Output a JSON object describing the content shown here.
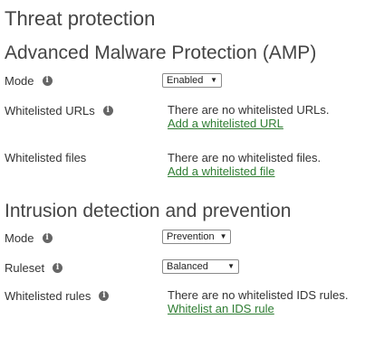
{
  "page_title": "Threat protection",
  "amp": {
    "title": "Advanced Malware Protection (AMP)",
    "mode_label": "Mode",
    "mode_value": "Enabled",
    "whitelisted_urls_label": "Whitelisted URLs",
    "whitelisted_urls_note": "There are no whitelisted URLs.",
    "add_url_link": "Add a whitelisted URL",
    "whitelisted_files_label": "Whitelisted files",
    "whitelisted_files_note": "There are no whitelisted files.",
    "add_file_link": "Add a whitelisted file"
  },
  "ids": {
    "title": "Intrusion detection and prevention",
    "mode_label": "Mode",
    "mode_value": "Prevention",
    "ruleset_label": "Ruleset",
    "ruleset_value": "Balanced",
    "whitelisted_rules_label": "Whitelisted rules",
    "whitelisted_rules_note": "There are no whitelisted IDS rules.",
    "add_rule_link": "Whitelist an IDS rule"
  },
  "icons": {
    "info": "info-icon",
    "dropdown": "chevron-down-icon"
  },
  "colors": {
    "link": "#2e7d32",
    "heading": "#444444"
  }
}
